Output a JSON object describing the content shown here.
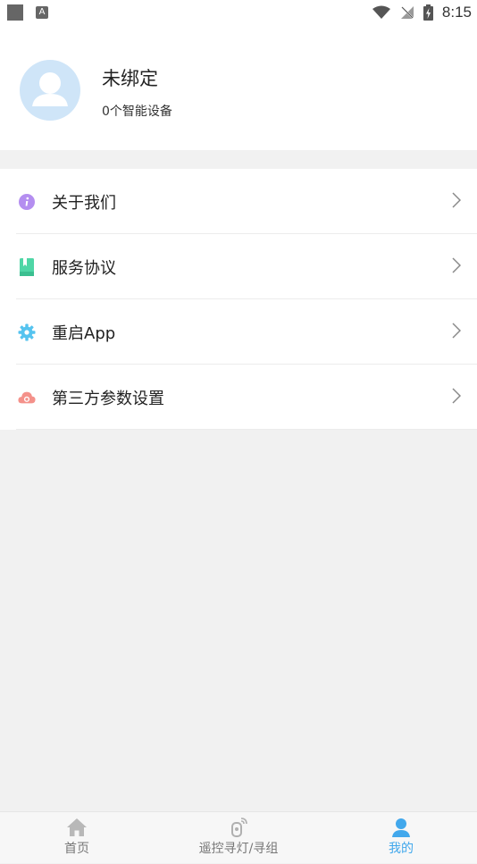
{
  "status_bar": {
    "notification_badge": "A",
    "time": "8:15"
  },
  "profile": {
    "name": "未绑定",
    "device_count": "0个智能设备"
  },
  "menu": {
    "items": [
      {
        "label": "关于我们",
        "icon": "info-icon",
        "color": "#b48ef0"
      },
      {
        "label": "服务协议",
        "icon": "book-icon",
        "color": "#4fd6a6"
      },
      {
        "label": "重启App",
        "icon": "gear-icon",
        "color": "#55c3ef"
      },
      {
        "label": "第三方参数设置",
        "icon": "cloud-icon",
        "color": "#f4918a"
      }
    ]
  },
  "tabbar": {
    "tabs": [
      {
        "label": "首页",
        "icon": "home-icon"
      },
      {
        "label": "遥控寻灯/寻组",
        "icon": "remote-signal-icon"
      },
      {
        "label": "我的",
        "icon": "user-icon",
        "active": true
      }
    ],
    "active_color": "#42a8ec",
    "inactive_color": "#777777"
  }
}
